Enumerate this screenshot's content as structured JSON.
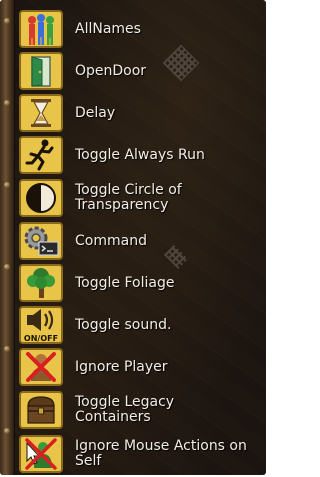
{
  "menu": {
    "items": [
      {
        "label": "AllNames",
        "icon": "all-names-icon"
      },
      {
        "label": "OpenDoor",
        "icon": "open-door-icon"
      },
      {
        "label": "Delay",
        "icon": "hourglass-icon"
      },
      {
        "label": "Toggle Always Run",
        "icon": "running-man-icon"
      },
      {
        "label": "Toggle Circle of\nTransparency",
        "icon": "half-circle-icon"
      },
      {
        "label": "Command",
        "icon": "gear-console-icon"
      },
      {
        "label": "Toggle Foliage",
        "icon": "tree-icon"
      },
      {
        "label": "Toggle sound.",
        "icon": "speaker-on-off-icon",
        "icon_text": "ON/OFF"
      },
      {
        "label": "Ignore Player",
        "icon": "ignore-player-icon"
      },
      {
        "label": "Toggle Legacy\nContainers",
        "icon": "chest-icon"
      },
      {
        "label": "Ignore Mouse Actions on\nSelf",
        "icon": "ignore-self-icon"
      }
    ]
  },
  "colors": {
    "text": "#f1ede4",
    "icon_frame": "#c9a13a",
    "background": "#1c1511"
  }
}
